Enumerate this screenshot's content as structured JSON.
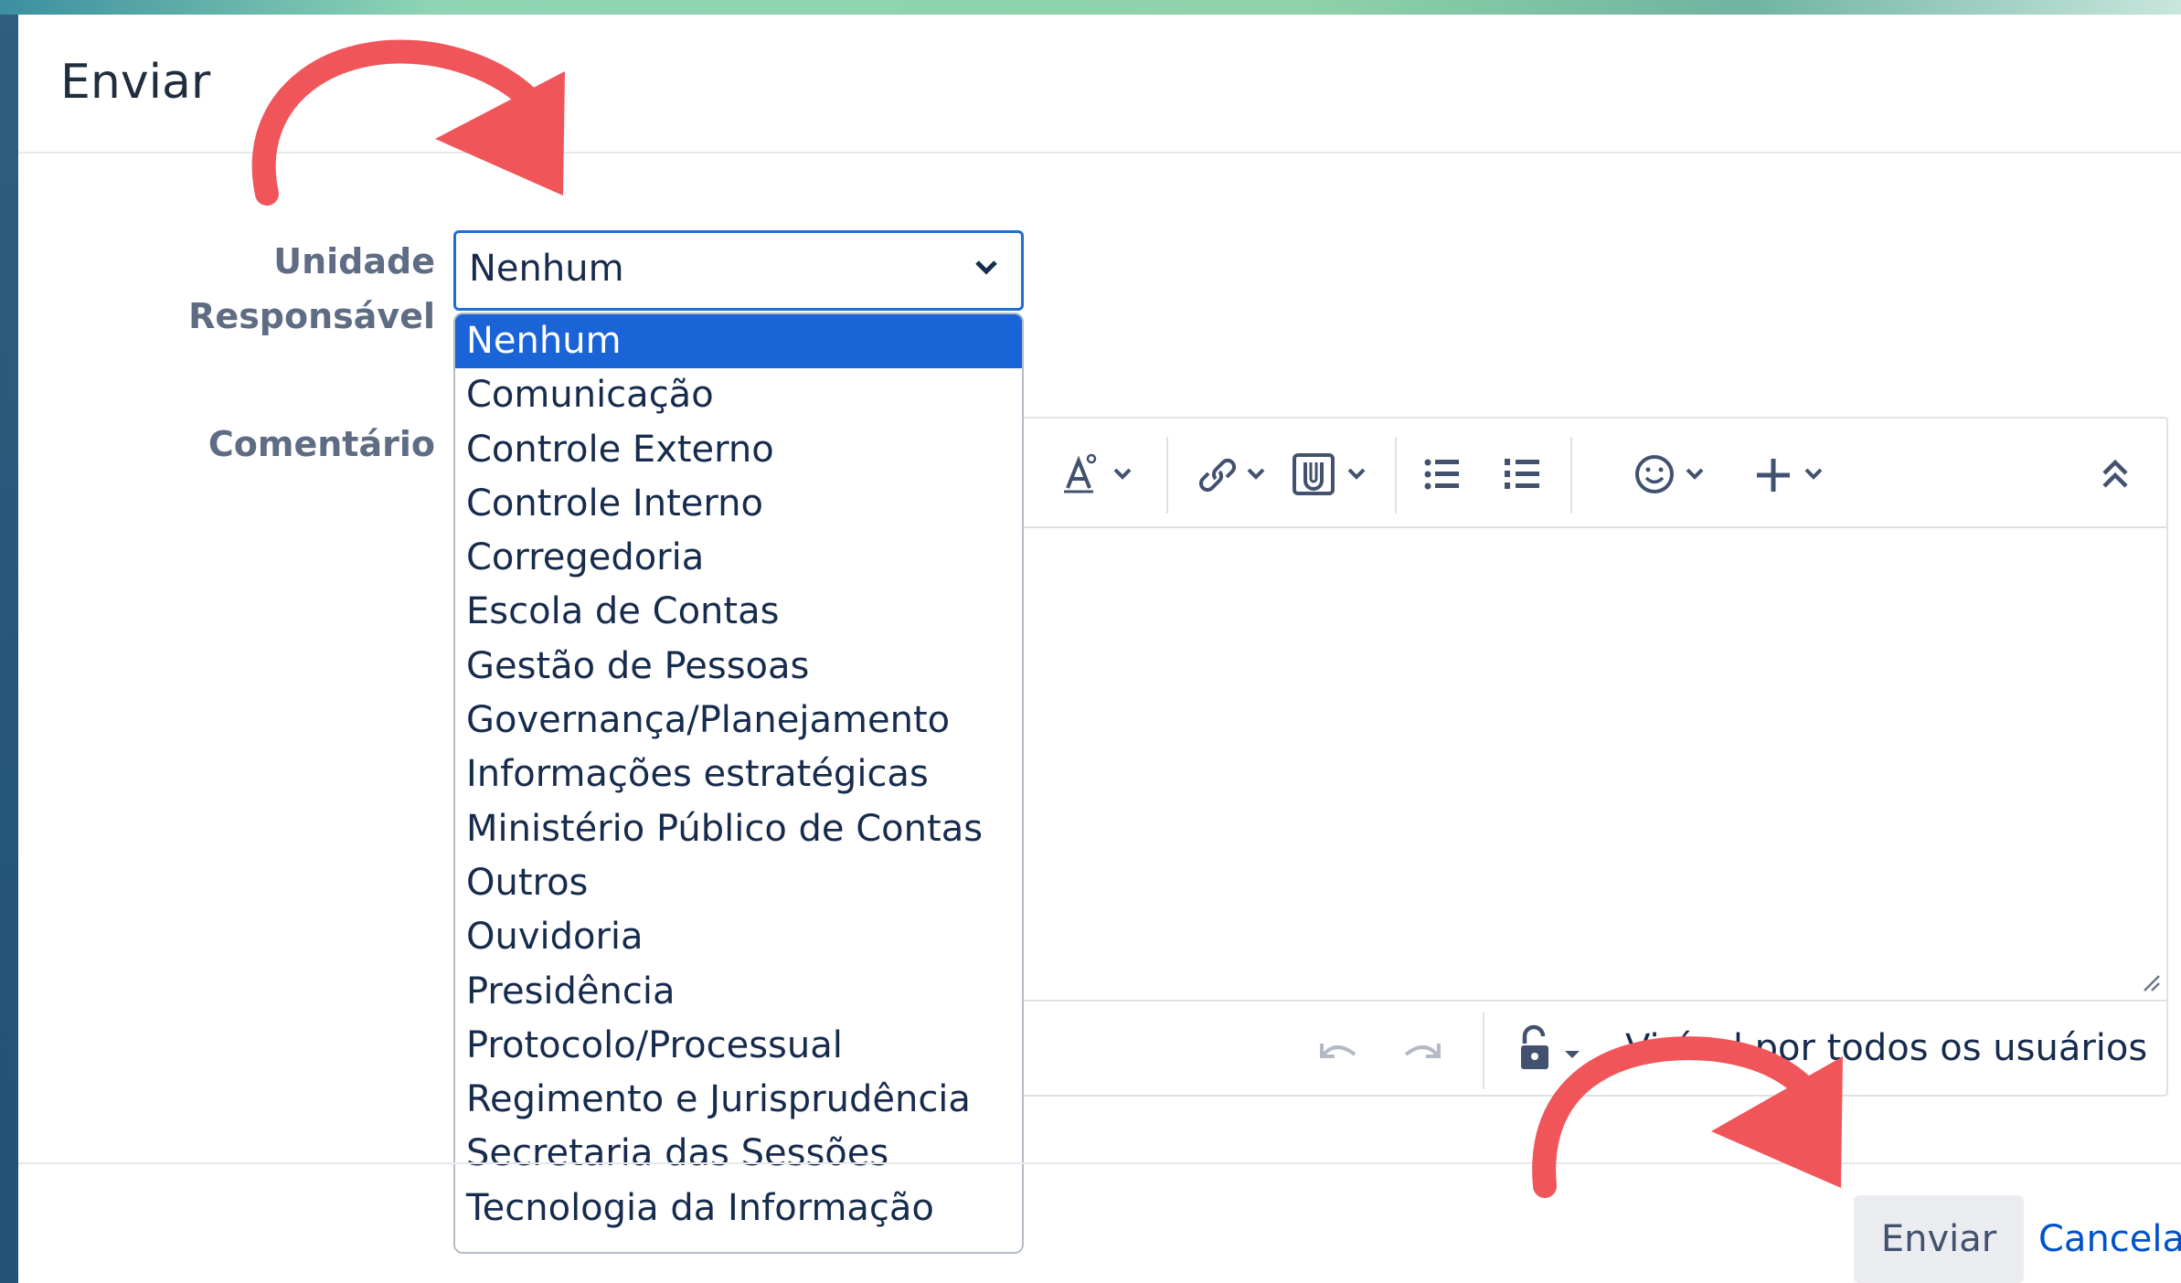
{
  "dialog": {
    "title": "Enviar"
  },
  "form": {
    "unit_label_line1": "Unidade",
    "unit_label_line2": "Responsável",
    "comment_label": "Comentário",
    "unit_select": {
      "selected": "Nenhum",
      "options": [
        "Nenhum",
        "Comunicação",
        "Controle Externo",
        "Controle Interno",
        "Corregedoria",
        "Escola de Contas",
        "Gestão de Pessoas",
        "Governança/Planejamento",
        "Informações estratégicas",
        "Ministério Público de Contas",
        "Outros",
        "Ouvidoria",
        "Presidência",
        "Protocolo/Processual",
        "Regimento e Jurisprudência",
        "Secretaria das Sessões",
        "Tecnologia da Informação"
      ]
    }
  },
  "editor": {
    "toolbar_icons": [
      "text-style-icon",
      "link-icon",
      "attachment-icon",
      "bullet-list-icon",
      "numbered-list-icon",
      "emoji-icon",
      "insert-plus-icon",
      "collapse-toolbar-icon"
    ],
    "visibility_text": "Visível por todos os usuários"
  },
  "footer": {
    "submit_label": "Enviar",
    "cancel_label": "Cancelar"
  },
  "colors": {
    "selected_option_bg": "#1b64d8",
    "focus_border": "#1f6ed4",
    "link": "#0052cc",
    "annotation_arrow": "#f0555a"
  }
}
